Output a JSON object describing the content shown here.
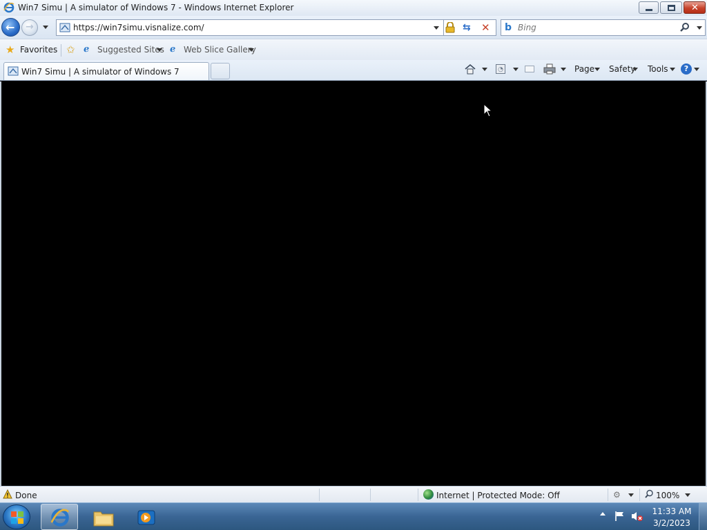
{
  "window": {
    "title": "Win7 Simu | A simulator of Windows 7 - Windows Internet Explorer"
  },
  "nav": {
    "address": "https://win7simu.visnalize.com/",
    "search_placeholder": "Bing"
  },
  "favorites_bar": {
    "favorites_label": "Favorites",
    "suggested_sites_label": "Suggested Sites",
    "web_slice_gallery_label": "Web Slice Gallery"
  },
  "tabs": [
    {
      "title": "Win7 Simu | A simulator of Windows 7",
      "active": true
    }
  ],
  "command_bar": {
    "page_label": "Page",
    "safety_label": "Safety",
    "tools_label": "Tools"
  },
  "status_bar": {
    "status_text": "Done",
    "zone_text": "Internet | Protected Mode: Off",
    "zoom_text": "100%"
  },
  "taskbar": {
    "clock_time": "11:33 AM",
    "clock_date": "3/2/2023"
  },
  "colors": {
    "content_background": "#000000",
    "taskbar": "#3a6594",
    "close_button": "#c7432b"
  },
  "icons": [
    "ie-logo-icon",
    "back-arrow-icon",
    "forward-arrow-icon",
    "dropdown-arrow-icon",
    "site-favicon-icon",
    "lock-icon",
    "refresh-icon",
    "stop-icon",
    "bing-icon",
    "search-icon",
    "star-icon",
    "add-favorites-icon",
    "home-icon",
    "feeds-icon",
    "mail-icon",
    "print-icon",
    "help-icon",
    "warning-icon",
    "globe-icon",
    "zoom-icon",
    "windows-logo-icon",
    "folder-icon",
    "media-player-icon",
    "flag-icon",
    "volume-muted-icon",
    "mouse-cursor-icon"
  ]
}
